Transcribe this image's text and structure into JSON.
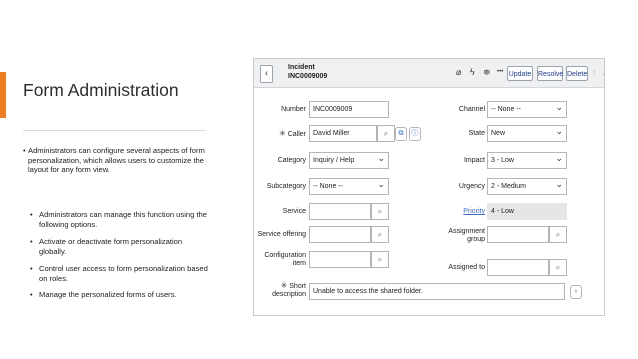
{
  "slide": {
    "title": "Form Administration",
    "intro_bullet": "Administrators can configure several aspects of form personalization, which allows users to customize the layout for any form view.",
    "bullets": [
      "Administrators can manage this function using the following options.",
      "Activate or deactivate form personalization globally.",
      "Control user access to form personalization based on roles.",
      "Manage the personalized forms of users."
    ],
    "bullet_glyph": "•",
    "accent_color": "#ef7d22"
  },
  "form": {
    "back_icon": "‹",
    "record_type": "Incident",
    "record_number": "INC0009009",
    "toolbar_icons": [
      "attachment-icon",
      "activity-icon",
      "settings-icon",
      "more-icon"
    ],
    "toolbar_glyphs": [
      "⌀",
      "ϟ",
      "≑",
      "•••"
    ],
    "buttons": {
      "update": "Update",
      "resolve": "Resolve",
      "delete": "Delete"
    },
    "nav_up": "↑",
    "nav_down": "↓",
    "search_glyph": "⌕",
    "fields": {
      "number": {
        "label": "Number",
        "value": "INC0009009"
      },
      "caller": {
        "label": "Caller",
        "value": "David Miller"
      },
      "category": {
        "label": "Category",
        "value": "Inquiry / Help"
      },
      "subcategory": {
        "label": "Subcategory",
        "value": "-- None --"
      },
      "service": {
        "label": "Service",
        "value": ""
      },
      "service_offering": {
        "label": "Service offering",
        "value": ""
      },
      "configuration_item": {
        "label": "Configuration item",
        "value": ""
      },
      "short_description": {
        "label": "Short description",
        "value": "Unable to access the shared folder."
      },
      "channel": {
        "label": "Channel",
        "value": "-- None --"
      },
      "state": {
        "label": "State",
        "value": "New"
      },
      "impact": {
        "label": "Impact",
        "value": "3 - Low"
      },
      "urgency": {
        "label": "Urgency",
        "value": "2 - Medium"
      },
      "priority": {
        "label": "Priority",
        "value": "4 - Low"
      },
      "assignment_group": {
        "label": "Assignment group",
        "value": ""
      },
      "assigned_to": {
        "label": "Assigned to",
        "value": ""
      }
    },
    "mandatory_glyph": "✳",
    "link_color": "#3a6fc4"
  }
}
